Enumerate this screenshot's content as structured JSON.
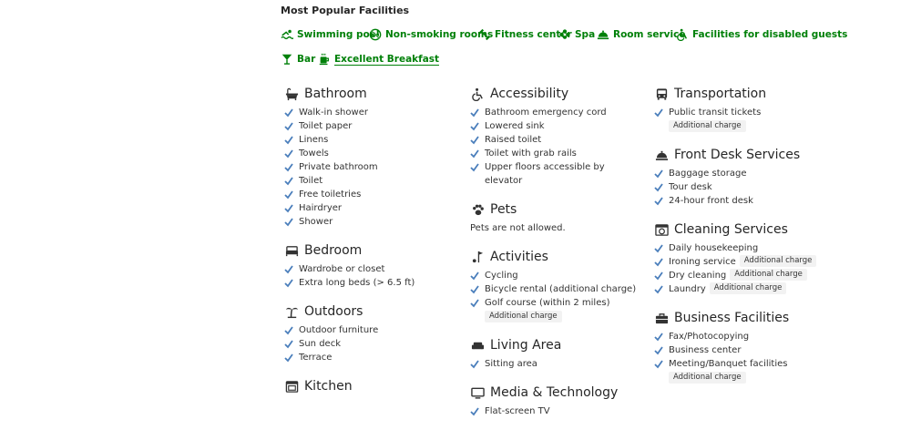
{
  "popular": {
    "title": "Most Popular Facilities",
    "items": [
      {
        "label": "Swimming pool",
        "icon": "swimming-pool-icon"
      },
      {
        "label": "Non-smoking rooms",
        "icon": "no-smoking-icon"
      },
      {
        "label": "Fitness center",
        "icon": "fitness-icon"
      },
      {
        "label": "Spa",
        "icon": "spa-icon"
      },
      {
        "label": "Room service",
        "icon": "room-service-icon"
      },
      {
        "label": "Facilities for disabled guests",
        "icon": "wheelchair-icon"
      },
      {
        "label": "Bar",
        "icon": "cocktail-icon"
      },
      {
        "label": "Excellent Breakfast",
        "icon": "coffee-icon"
      }
    ]
  },
  "accent_color": "#008009",
  "check_color": "#4a7ebb",
  "sections": {
    "bathroom": {
      "title": "Bathroom",
      "items": [
        "Walk-in shower",
        "Toilet paper",
        "Linens",
        "Towels",
        "Private bathroom",
        "Toilet",
        "Free toiletries",
        "Hairdryer",
        "Shower"
      ]
    },
    "bedroom": {
      "title": "Bedroom",
      "items": [
        "Wardrobe or closet",
        "Extra long beds (> 6.5 ft)"
      ]
    },
    "outdoors": {
      "title": "Outdoors",
      "items": [
        "Outdoor furniture",
        "Sun deck",
        "Terrace"
      ]
    },
    "kitchen": {
      "title": "Kitchen"
    },
    "accessibility": {
      "title": "Accessibility",
      "items": [
        "Bathroom emergency cord",
        "Lowered sink",
        "Raised toilet",
        "Toilet with grab rails",
        "Upper floors accessible by elevator"
      ]
    },
    "pets": {
      "title": "Pets",
      "note": "Pets are not allowed."
    },
    "activities": {
      "title": "Activities",
      "items": [
        "Cycling",
        "Bicycle rental (additional charge)",
        "Golf course (within 2 miles)"
      ],
      "badge": "Additional charge"
    },
    "living": {
      "title": "Living Area",
      "items": [
        "Sitting area"
      ]
    },
    "media": {
      "title": "Media & Technology",
      "items": [
        "Flat-screen TV"
      ]
    },
    "transportation": {
      "title": "Transportation",
      "items": [
        "Public transit tickets"
      ],
      "badge": "Additional charge"
    },
    "frontdesk": {
      "title": "Front Desk Services",
      "items": [
        "Baggage storage",
        "Tour desk",
        "24-hour front desk"
      ]
    },
    "cleaning": {
      "title": "Cleaning Services",
      "items": [
        "Daily housekeeping",
        "Ironing service",
        "Dry cleaning",
        "Laundry"
      ],
      "badge": "Additional charge"
    },
    "business": {
      "title": "Business Facilities",
      "items": [
        "Fax/Photocopying",
        "Business center",
        "Meeting/Banquet facilities"
      ],
      "badge": "Additional charge"
    }
  }
}
